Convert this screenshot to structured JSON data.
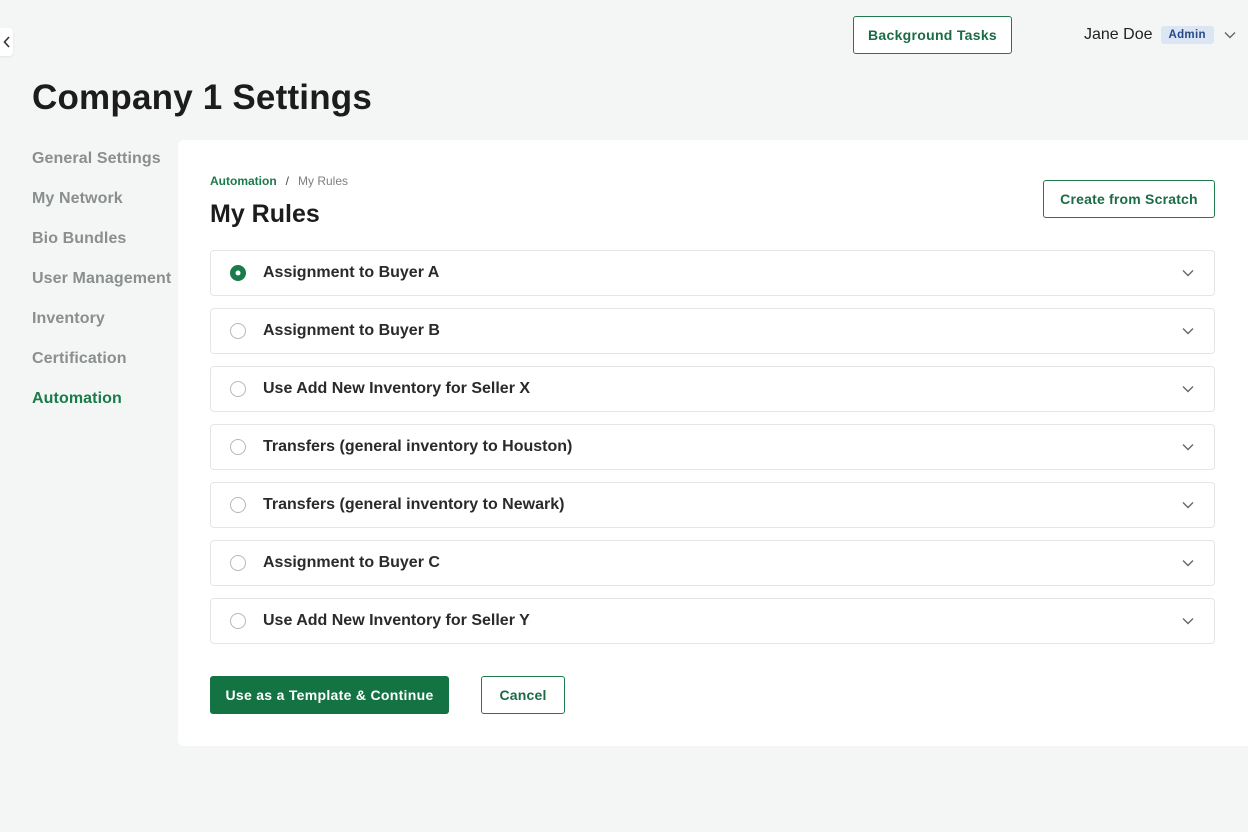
{
  "header": {
    "background_tasks_label": "Background Tasks",
    "user_name": "Jane Doe",
    "user_role": "Admin"
  },
  "page": {
    "title": "Company 1 Settings"
  },
  "sidebar": {
    "items": [
      {
        "label": "General Settings",
        "active": false
      },
      {
        "label": "My Network",
        "active": false
      },
      {
        "label": "Bio Bundles",
        "active": false
      },
      {
        "label": "User Management",
        "active": false
      },
      {
        "label": "Inventory",
        "active": false
      },
      {
        "label": "Certification",
        "active": false
      },
      {
        "label": "Automation",
        "active": true
      }
    ]
  },
  "content": {
    "breadcrumb": {
      "parent": "Automation",
      "separator": "/",
      "current": "My Rules"
    },
    "title": "My Rules",
    "create_button": "Create from Scratch",
    "rules": [
      {
        "label": "Assignment to Buyer A",
        "selected": true
      },
      {
        "label": "Assignment to Buyer B",
        "selected": false
      },
      {
        "label": "Use Add New Inventory for Seller X",
        "selected": false
      },
      {
        "label": "Transfers (general inventory to Houston)",
        "selected": false
      },
      {
        "label": "Transfers (general inventory to Newark)",
        "selected": false
      },
      {
        "label": "Assignment to Buyer C",
        "selected": false
      },
      {
        "label": "Use Add New Inventory for Seller Y",
        "selected": false
      }
    ],
    "primary_button": "Use as a Template & Continue",
    "cancel_button": "Cancel"
  },
  "colors": {
    "accent": "#1b7a4a",
    "primary_button_bg": "#137343",
    "page_bg": "#f4f6f5",
    "badge_bg": "#dbe5f3"
  },
  "icons": {
    "edge_tab": "chevron-left-icon",
    "user_menu": "chevron-down-icon",
    "rule_expand": "chevron-down-icon"
  }
}
